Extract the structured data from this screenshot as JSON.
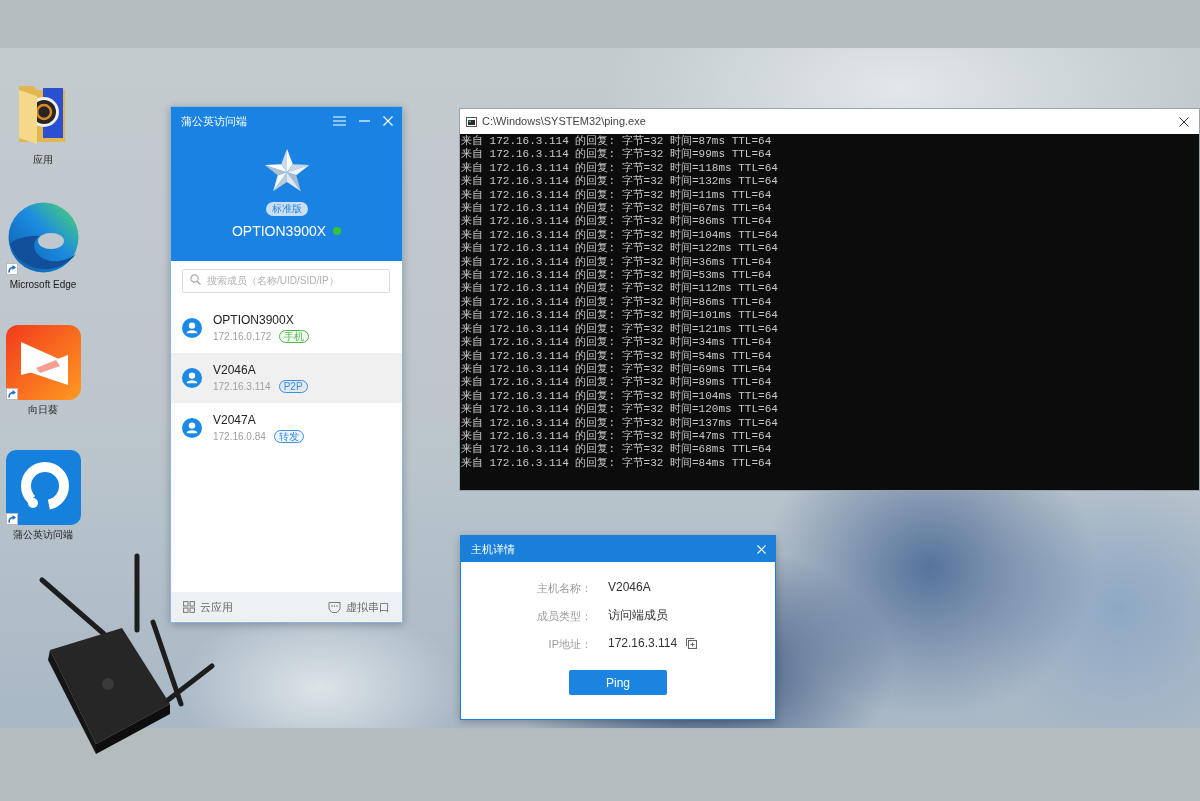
{
  "desktop": {
    "icons": [
      {
        "kind": "folder",
        "label": "应用",
        "shortcut": false
      },
      {
        "kind": "swirl",
        "label": "Microsoft Edge",
        "shortcut": true
      },
      {
        "kind": "triangles",
        "label": "向日葵",
        "shortcut": true
      },
      {
        "kind": "ring",
        "label": "蒲公英访问端",
        "shortcut": true
      }
    ]
  },
  "app_window": {
    "title": "蒲公英访问端",
    "edition": "标准版",
    "device_name": "OPTION3900X",
    "online": true,
    "search": {
      "placeholder": "搜索成员（名称/UID/SID/IP）"
    },
    "members": [
      {
        "name": "OPTION3900X",
        "ip": "172.16.0.172",
        "tag": "手机",
        "color": "#4cb84c",
        "selected": false
      },
      {
        "name": "V2046A",
        "ip": "172.16.3.114",
        "tag": "P2P",
        "color": "#3a8ee6",
        "selected": true
      },
      {
        "name": "V2047A",
        "ip": "172.16.0.84",
        "tag": "转发",
        "color": "#3a8ee6",
        "selected": false
      }
    ],
    "footer": [
      {
        "kind": "grid",
        "label": "云应用"
      },
      {
        "kind": "serial",
        "label": "虚拟串口"
      }
    ]
  },
  "console": {
    "title": "C:\\Windows\\SYSTEM32\\ping.exe",
    "lines": [
      "来自 172.16.3.114 的回复: 字节=32 时间=87ms TTL=64",
      "来自 172.16.3.114 的回复: 字节=32 时间=99ms TTL=64",
      "来自 172.16.3.114 的回复: 字节=32 时间=118ms TTL=64",
      "来自 172.16.3.114 的回复: 字节=32 时间=132ms TTL=64",
      "来自 172.16.3.114 的回复: 字节=32 时间=11ms TTL=64",
      "来自 172.16.3.114 的回复: 字节=32 时间=67ms TTL=64",
      "来自 172.16.3.114 的回复: 字节=32 时间=86ms TTL=64",
      "来自 172.16.3.114 的回复: 字节=32 时间=104ms TTL=64",
      "来自 172.16.3.114 的回复: 字节=32 时间=122ms TTL=64",
      "来自 172.16.3.114 的回复: 字节=32 时间=36ms TTL=64",
      "来自 172.16.3.114 的回复: 字节=32 时间=53ms TTL=64",
      "来自 172.16.3.114 的回复: 字节=32 时间=112ms TTL=64",
      "来自 172.16.3.114 的回复: 字节=32 时间=86ms TTL=64",
      "来自 172.16.3.114 的回复: 字节=32 时间=101ms TTL=64",
      "来自 172.16.3.114 的回复: 字节=32 时间=121ms TTL=64",
      "来自 172.16.3.114 的回复: 字节=32 时间=34ms TTL=64",
      "来自 172.16.3.114 的回复: 字节=32 时间=54ms TTL=64",
      "来自 172.16.3.114 的回复: 字节=32 时间=69ms TTL=64",
      "来自 172.16.3.114 的回复: 字节=32 时间=89ms TTL=64",
      "来自 172.16.3.114 的回复: 字节=32 时间=104ms TTL=64",
      "来自 172.16.3.114 的回复: 字节=32 时间=120ms TTL=64",
      "来自 172.16.3.114 的回复: 字节=32 时间=137ms TTL=64",
      "来自 172.16.3.114 的回复: 字节=32 时间=47ms TTL=64",
      "来自 172.16.3.114 的回复: 字节=32 时间=68ms TTL=64",
      "来自 172.16.3.114 的回复: 字节=32 时间=84ms TTL=64"
    ]
  },
  "dialog": {
    "title": "主机详情",
    "fields": [
      {
        "label": "主机名称：",
        "value": "V2046A",
        "copyable": false
      },
      {
        "label": "成员类型：",
        "value": "访问端成员",
        "copyable": false
      },
      {
        "label": "IP地址：",
        "value": "172.16.3.114",
        "copyable": true
      }
    ],
    "button": "Ping"
  }
}
